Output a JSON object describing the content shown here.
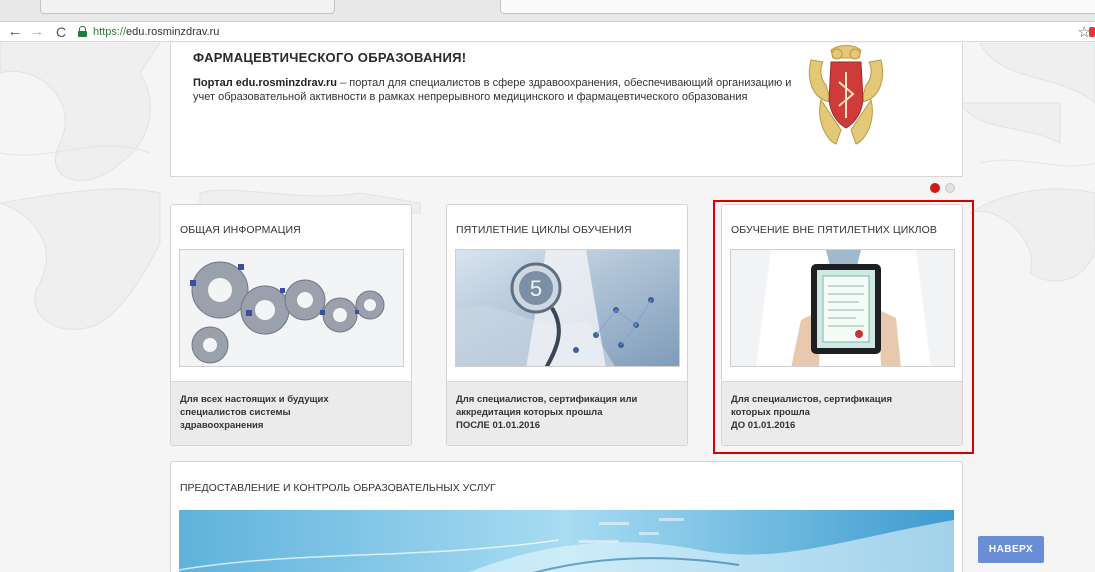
{
  "browser": {
    "url_prefix": "https://",
    "url_host": "edu.rosminzdrav.ru",
    "back_glyph": "←",
    "forward_glyph": "→",
    "reload_glyph": "C",
    "star_glyph": "☆"
  },
  "slider": {
    "title": "ФАРМАЦЕВТИЧЕСКОГО ОБРАЗОВАНИЯ!",
    "text_bold": "Портал edu.rosminzdrav.ru",
    "text_rest": " – портал для специалистов в сфере здравоохранения, обеспечивающий организацию и учет образовательной активности в рамках непрерывного медицинского и фармацевтического образования",
    "emblem_icon": "double-headed-eagle-emblem"
  },
  "cards": [
    {
      "title": "ОБЩАЯ ИНФОРМАЦИЯ",
      "image": "gears-image",
      "lines": [
        "Для всех настоящих и будущих",
        "специалистов системы",
        "здравоохранения"
      ]
    },
    {
      "title": "ПЯТИЛЕТНИЕ ЦИКЛЫ ОБУЧЕНИЯ",
      "image": "stethoscope-five-image",
      "badge": "5",
      "lines": [
        "Для специалистов, сертификация или",
        "аккредитация которых прошла",
        "ПОСЛЕ 01.01.2016"
      ]
    },
    {
      "title": "ОБУЧЕНИЕ ВНЕ ПЯТИЛЕТНИХ ЦИКЛОВ",
      "image": "tablet-certificate-image",
      "lines": [
        "Для специалистов, сертификация",
        "которых прошла",
        "ДО 01.01.2016"
      ]
    }
  ],
  "panel": {
    "title": "ПРЕДОСТАВЛЕНИЕ И КОНТРОЛЬ ОБРАЗОВАТЕЛЬНЫХ УСЛУГ"
  },
  "top_button": "НАВЕРХ",
  "colors": {
    "highlight": "#d50000",
    "dot_active": "#d01a1a",
    "top_button": "#6b8dd6"
  }
}
